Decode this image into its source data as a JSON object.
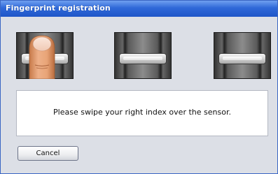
{
  "window": {
    "title": "Fingerprint registration"
  },
  "sensors": [
    {
      "state": "finger-placed",
      "icon": "finger-on-sensor-icon"
    },
    {
      "state": "empty",
      "icon": "fingerprint-sensor-icon"
    },
    {
      "state": "empty",
      "icon": "fingerprint-sensor-icon"
    }
  ],
  "message": {
    "text": "Please swipe your right index over the sensor."
  },
  "buttons": {
    "cancel_label": "Cancel"
  },
  "colors": {
    "title_bar": "#2f68d8",
    "window_bg": "#dcdfe6",
    "finger_skin": "#e8a477"
  }
}
